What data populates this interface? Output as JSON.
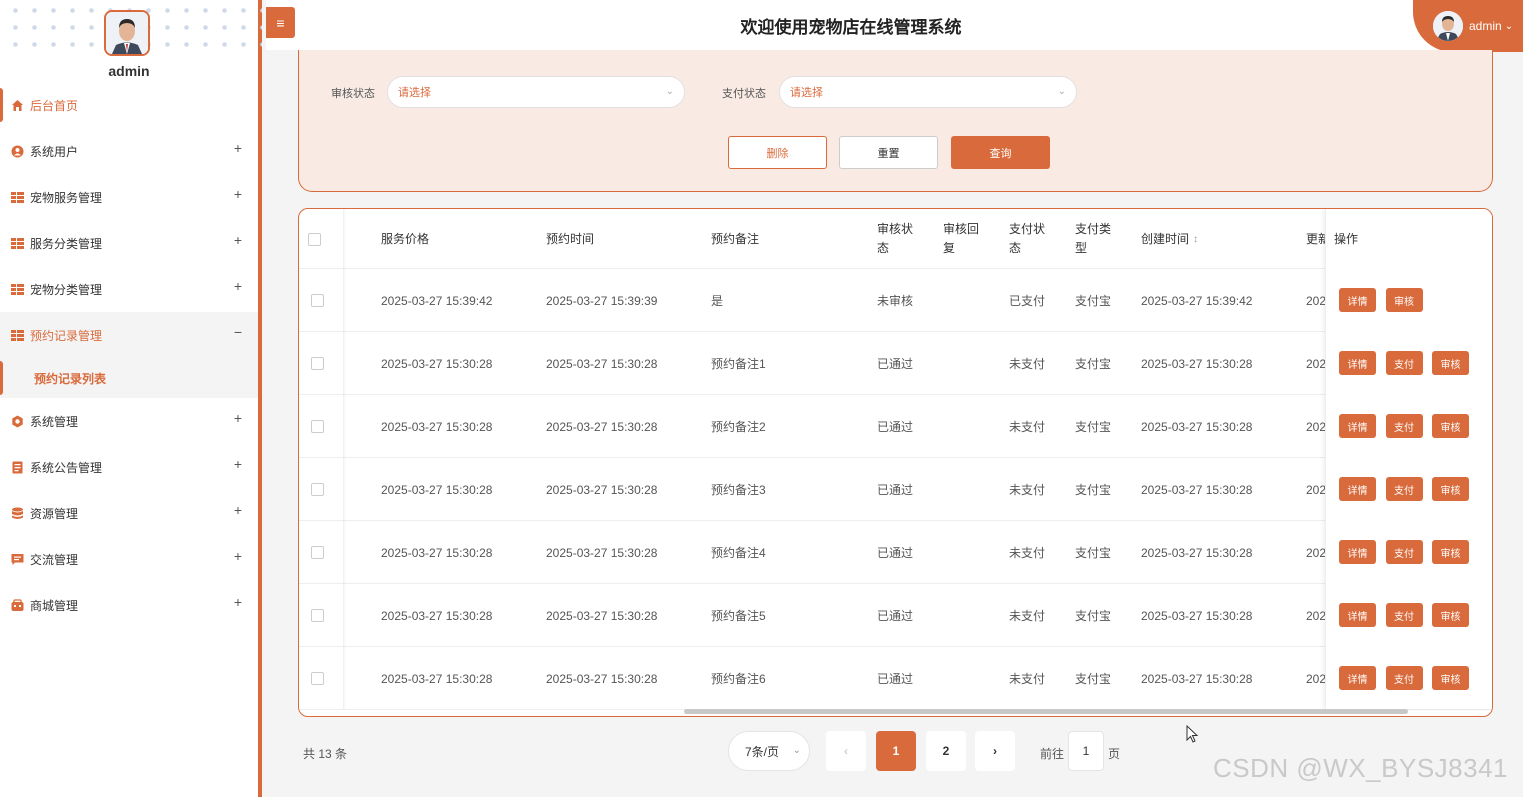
{
  "app": {
    "title": "欢迎使用宠物店在线管理系统",
    "user": "admin",
    "hamburger": "≡",
    "user_chevron": "⌄"
  },
  "sidebar": {
    "username": "admin",
    "items": [
      {
        "label": "后台首页",
        "icon": "home-icon",
        "expand": ""
      },
      {
        "label": "系统用户",
        "icon": "user-icon",
        "expand": "+"
      },
      {
        "label": "宠物服务管理",
        "icon": "grid-icon",
        "expand": "+"
      },
      {
        "label": "服务分类管理",
        "icon": "grid-icon",
        "expand": "+"
      },
      {
        "label": "宠物分类管理",
        "icon": "grid-icon",
        "expand": "+"
      },
      {
        "label": "预约记录管理",
        "icon": "grid-icon",
        "expand": "−"
      },
      {
        "label": "系统管理",
        "icon": "gear-icon",
        "expand": "+"
      },
      {
        "label": "系统公告管理",
        "icon": "doc-icon",
        "expand": "+"
      },
      {
        "label": "资源管理",
        "icon": "database-icon",
        "expand": "+"
      },
      {
        "label": "交流管理",
        "icon": "chat-icon",
        "expand": "+"
      },
      {
        "label": "商城管理",
        "icon": "shop-icon",
        "expand": "+"
      }
    ],
    "submenu": {
      "label": "预约记录列表"
    }
  },
  "search": {
    "audit_label": "审核状态",
    "audit_placeholder": "请选择",
    "pay_label": "支付状态",
    "pay_placeholder": "请选择",
    "delete_label": "删除",
    "reset_label": "重置",
    "query_label": "查询"
  },
  "table": {
    "headers": {
      "price": "服务价格",
      "appt_time": "预约时间",
      "note": "预约备注",
      "audit_status": "审核状态",
      "audit_reply": "审核回复",
      "pay_status": "支付状态",
      "pay_type": "支付类型",
      "created": "创建时间",
      "updated": "更新",
      "ops": "操作"
    },
    "sort_icon": "↕",
    "rows": [
      {
        "price": "2025-03-27 15:39:42",
        "appt_time": "2025-03-27 15:39:39",
        "note": "是",
        "audit_status": "未审核",
        "audit_reply": "",
        "pay_status": "已支付",
        "pay_type": "支付宝",
        "created": "2025-03-27 15:39:42",
        "updated": "202"
      },
      {
        "price": "2025-03-27 15:30:28",
        "appt_time": "2025-03-27 15:30:28",
        "note": "预约备注1",
        "audit_status": "已通过",
        "audit_reply": "",
        "pay_status": "未支付",
        "pay_type": "支付宝",
        "created": "2025-03-27 15:30:28",
        "updated": "202"
      },
      {
        "price": "2025-03-27 15:30:28",
        "appt_time": "2025-03-27 15:30:28",
        "note": "预约备注2",
        "audit_status": "已通过",
        "audit_reply": "",
        "pay_status": "未支付",
        "pay_type": "支付宝",
        "created": "2025-03-27 15:30:28",
        "updated": "202"
      },
      {
        "price": "2025-03-27 15:30:28",
        "appt_time": "2025-03-27 15:30:28",
        "note": "预约备注3",
        "audit_status": "已通过",
        "audit_reply": "",
        "pay_status": "未支付",
        "pay_type": "支付宝",
        "created": "2025-03-27 15:30:28",
        "updated": "202"
      },
      {
        "price": "2025-03-27 15:30:28",
        "appt_time": "2025-03-27 15:30:28",
        "note": "预约备注4",
        "audit_status": "已通过",
        "audit_reply": "",
        "pay_status": "未支付",
        "pay_type": "支付宝",
        "created": "2025-03-27 15:30:28",
        "updated": "202"
      },
      {
        "price": "2025-03-27 15:30:28",
        "appt_time": "2025-03-27 15:30:28",
        "note": "预约备注5",
        "audit_status": "已通过",
        "audit_reply": "",
        "pay_status": "未支付",
        "pay_type": "支付宝",
        "created": "2025-03-27 15:30:28",
        "updated": "202"
      },
      {
        "price": "2025-03-27 15:30:28",
        "appt_time": "2025-03-27 15:30:28",
        "note": "预约备注6",
        "audit_status": "已通过",
        "audit_reply": "",
        "pay_status": "未支付",
        "pay_type": "支付宝",
        "created": "2025-03-27 15:30:28",
        "updated": "202"
      }
    ],
    "ops": {
      "first_row": [
        "详情",
        "审核"
      ],
      "other_rows": [
        "详情",
        "支付",
        "审核"
      ]
    }
  },
  "pagination": {
    "total": "共 13 条",
    "page_size": "7条/页",
    "prev": "‹",
    "pages": [
      "1",
      "2"
    ],
    "current_page": "1",
    "next": "›",
    "goto_prefix": "前往",
    "goto_value": "1",
    "goto_suffix": "页"
  },
  "watermark": "CSDN @WX_BYSJ8341",
  "colors": {
    "accent": "#d96a3b",
    "panel_bg": "#f9ebe4",
    "page_bg": "#f4f4f4"
  }
}
